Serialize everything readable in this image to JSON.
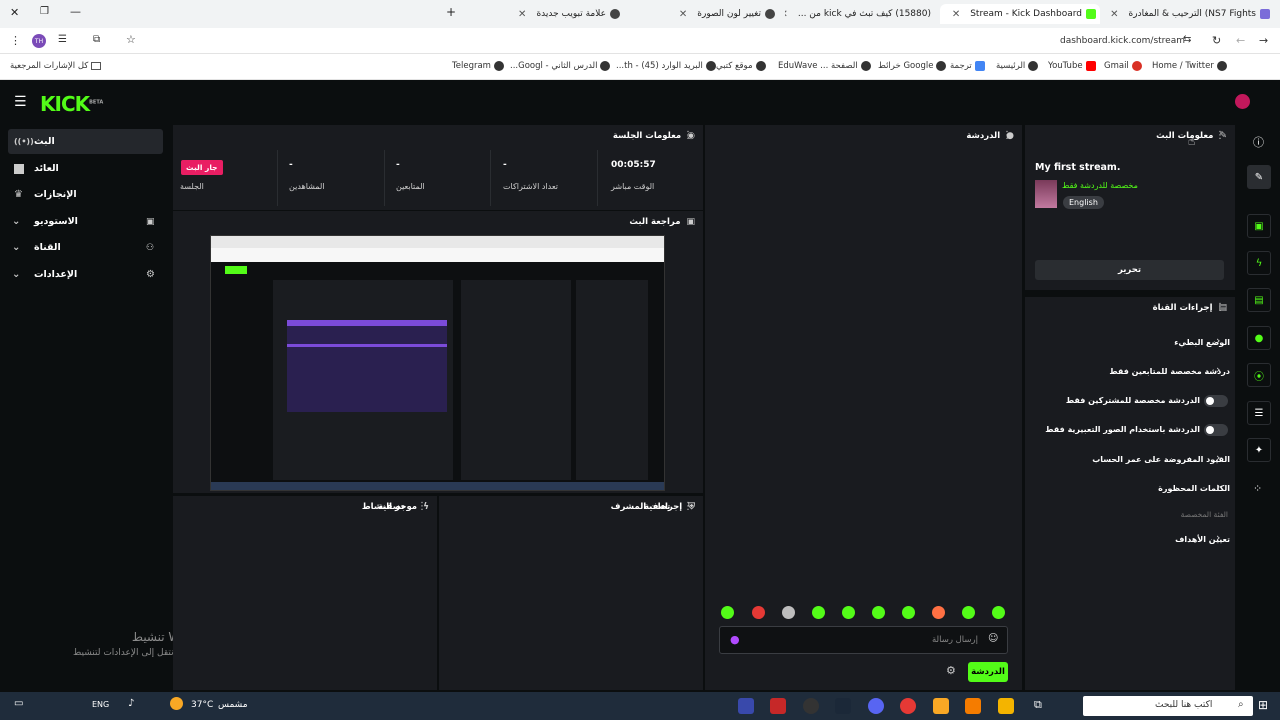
{
  "browser": {
    "tabs": [
      {
        "title": "NS7 Fights) الترحيب & المغادرة",
        "color": "#7b6cd9"
      },
      {
        "title": "Stream - Kick Dashboard",
        "color": "#53fc18",
        "active": true
      },
      {
        "title": "(15880) كيف تبث في kick من ...",
        "color": "#ff0000"
      },
      {
        "title": "تغيير لون الصورة",
        "color": "#444444"
      },
      {
        "title": "علامة تبويب جديدة",
        "color": "#444444"
      }
    ],
    "url": "dashboard.kick.com/stream",
    "profile_initial": "TH",
    "bookmarks_all": "كل الإشارات المرجعية",
    "bookmarks": [
      "Home / Twitter",
      "Gmail",
      "YouTube",
      "الرئيسية",
      "ترجمة",
      "Google خرائط",
      "الصفحة ... EduWave",
      "موقع كتبي",
      "البريد الوارد (45) - th...",
      "الدرس الثاني - Googl...",
      "Telegram"
    ]
  },
  "sidebar": {
    "items": [
      {
        "label": "البث",
        "icon": "broadcast-icon",
        "active": true
      },
      {
        "label": "العائد",
        "icon": "grid-icon"
      },
      {
        "label": "الإنجازات",
        "icon": "trophy-icon"
      },
      {
        "label": "الاستوديو",
        "icon": "studio-icon",
        "expandable": true
      },
      {
        "label": "القناة",
        "icon": "users-icon",
        "expandable": true
      },
      {
        "label": "الإعدادات",
        "icon": "gear-icon",
        "expandable": true
      }
    ]
  },
  "session": {
    "title": "معلومات الجلسة",
    "live_badge": "جار البث",
    "stats": [
      {
        "label": "الوقت مباشر",
        "value": "00:05:57"
      },
      {
        "label": "تعداد الاشتراكات",
        "value": "-"
      },
      {
        "label": "المتابعين",
        "value": "-"
      },
      {
        "label": "المشاهدين",
        "value": "-"
      },
      {
        "label": "الجلسة",
        "value": ""
      }
    ]
  },
  "preview": {
    "title": "مراجعة البث"
  },
  "activity": {
    "title": "موجز النشاط",
    "filter": "تصفية"
  },
  "mod": {
    "title": "إجراءات المشرف",
    "filter": "تصفية"
  },
  "chat": {
    "title": "الدردشة",
    "placeholder": "إرسال رسالة",
    "send": "الدردشة"
  },
  "stream_info": {
    "title": "معلومات البث",
    "stream_title": "My first stream.",
    "category": "مخصصة للدردشة فقط",
    "language": "English",
    "edit": "تحرير"
  },
  "channel_actions": {
    "title": "إجراءات القناة",
    "items": [
      {
        "label": "الوضع البطيء",
        "type": "chevron"
      },
      {
        "label": "دردشة مخصصة للمتابعين فقط",
        "type": "chevron"
      },
      {
        "label": "الدردشة مخصصة للمشتركين فقط",
        "type": "toggle"
      },
      {
        "label": "الدردشة باستخدام الصور التعبيرية فقط",
        "type": "toggle"
      },
      {
        "label": "القيود المفروضة على عمر الحساب",
        "type": "chevron"
      },
      {
        "label": "الكلمات المحظورة",
        "type": "chevron"
      }
    ],
    "section_label": "الفئة المخصصة",
    "goals": "تعيين الأهداف"
  },
  "windows": {
    "activate_title": "تنشيط Windows",
    "activate_sub": "انتقل إلى الإعدادات لتنشيط Windows."
  },
  "taskbar": {
    "search": "اكتب هنا للبحث",
    "weather_temp": "37°C",
    "weather_label": "مشمس",
    "lang": "ENG"
  },
  "colors": {
    "accent": "#53fc18",
    "live": "#e91e63"
  }
}
